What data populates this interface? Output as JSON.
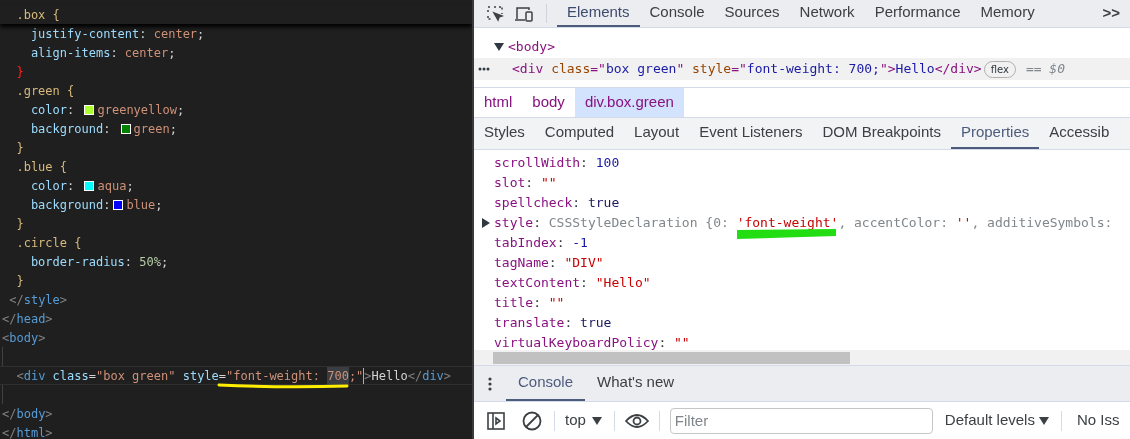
{
  "editor": {
    "lines": [
      {
        "tokens": [
          {
            "text": "  .box",
            "kind": "selector"
          },
          {
            "text": " {",
            "kind": "brace"
          }
        ],
        "sticky": true
      },
      {
        "tokens": [
          {
            "text": "    justify-content",
            "kind": "prop"
          },
          {
            "text": ": ",
            "kind": "text"
          },
          {
            "text": "center",
            "kind": "value"
          },
          {
            "text": ";",
            "kind": "text"
          }
        ]
      },
      {
        "tokens": [
          {
            "text": "    align-items",
            "kind": "prop"
          },
          {
            "text": ": ",
            "kind": "text"
          },
          {
            "text": "center",
            "kind": "value"
          },
          {
            "text": ";",
            "kind": "text"
          }
        ]
      },
      {
        "tokens": [
          {
            "text": "  }",
            "kind": "brace_error"
          }
        ]
      },
      {
        "tokens": [
          {
            "text": "  .green",
            "kind": "selector"
          },
          {
            "text": " {",
            "kind": "brace"
          }
        ]
      },
      {
        "tokens": [
          {
            "text": "    color",
            "kind": "prop"
          },
          {
            "text": ": ",
            "kind": "text"
          },
          {
            "kind": "swatch",
            "color": "#adff2f"
          },
          {
            "text": "greenyellow",
            "kind": "value"
          },
          {
            "text": ";",
            "kind": "text"
          }
        ]
      },
      {
        "tokens": [
          {
            "text": "    background",
            "kind": "prop"
          },
          {
            "text": ": ",
            "kind": "text"
          },
          {
            "kind": "swatch",
            "color": "#008000"
          },
          {
            "text": "green",
            "kind": "value"
          },
          {
            "text": ";",
            "kind": "text"
          }
        ]
      },
      {
        "tokens": [
          {
            "text": "  }",
            "kind": "brace"
          }
        ]
      },
      {
        "tokens": [
          {
            "text": "  .blue",
            "kind": "selector"
          },
          {
            "text": " {",
            "kind": "brace"
          }
        ]
      },
      {
        "tokens": [
          {
            "text": "    color",
            "kind": "prop"
          },
          {
            "text": ": ",
            "kind": "text"
          },
          {
            "kind": "swatch",
            "color": "#00ffff"
          },
          {
            "text": "aqua",
            "kind": "value"
          },
          {
            "text": ";",
            "kind": "text"
          }
        ]
      },
      {
        "tokens": [
          {
            "text": "    background",
            "kind": "prop"
          },
          {
            "text": ":",
            "kind": "text"
          },
          {
            "kind": "swatch",
            "color": "#0000ff"
          },
          {
            "text": "blue",
            "kind": "value"
          },
          {
            "text": ";",
            "kind": "text"
          }
        ]
      },
      {
        "tokens": [
          {
            "text": "  }",
            "kind": "brace"
          }
        ]
      },
      {
        "tokens": [
          {
            "text": "  .circle",
            "kind": "selector"
          },
          {
            "text": " {",
            "kind": "brace"
          }
        ]
      },
      {
        "tokens": [
          {
            "text": "    border-radius",
            "kind": "prop"
          },
          {
            "text": ": ",
            "kind": "text"
          },
          {
            "text": "50%",
            "kind": "number"
          },
          {
            "text": ";",
            "kind": "text"
          }
        ]
      },
      {
        "tokens": [
          {
            "text": "  }",
            "kind": "brace"
          }
        ]
      },
      {
        "tokens": [
          {
            "text": " </",
            "kind": "punct"
          },
          {
            "text": "style",
            "kind": "tag"
          },
          {
            "text": ">",
            "kind": "punct"
          }
        ]
      },
      {
        "tokens": [
          {
            "text": "</",
            "kind": "punct"
          },
          {
            "text": "head",
            "kind": "tag"
          },
          {
            "text": ">",
            "kind": "punct"
          }
        ]
      },
      {
        "tokens": [
          {
            "text": "<",
            "kind": "punct"
          },
          {
            "text": "body",
            "kind": "tag"
          },
          {
            "text": ">",
            "kind": "punct"
          }
        ]
      },
      {
        "kind": "blank"
      },
      {
        "tokens": [
          {
            "text": "  <",
            "kind": "punct"
          },
          {
            "text": "div",
            "kind": "tag"
          },
          {
            "text": " class",
            "kind": "attr"
          },
          {
            "text": "=",
            "kind": "text"
          },
          {
            "text": "\"box green\"",
            "kind": "value"
          },
          {
            "text": " style",
            "kind": "attr"
          },
          {
            "text": "=",
            "kind": "text"
          },
          {
            "text": "\"font-weight: ",
            "kind": "value"
          },
          {
            "text": "700",
            "kind": "selection"
          },
          {
            "text": ";\"",
            "kind": "value"
          },
          {
            "kind": "cursor"
          },
          {
            "text": ">",
            "kind": "punct"
          },
          {
            "text": "Hello",
            "kind": "text"
          },
          {
            "text": "</",
            "kind": "punct"
          },
          {
            "text": "div",
            "kind": "tag"
          },
          {
            "text": ">",
            "kind": "punct"
          }
        ],
        "current": true
      },
      {
        "kind": "blank"
      },
      {
        "tokens": [
          {
            "text": "</",
            "kind": "punct"
          },
          {
            "text": "body",
            "kind": "tag"
          },
          {
            "text": ">",
            "kind": "punct"
          }
        ]
      },
      {
        "tokens": [
          {
            "text": "</",
            "kind": "punct"
          },
          {
            "text": "html",
            "kind": "tag"
          },
          {
            "text": ">",
            "kind": "punct"
          }
        ]
      }
    ]
  },
  "devtools": {
    "tabs": [
      {
        "label": "Elements",
        "selected": true
      },
      {
        "label": "Console",
        "selected": false
      },
      {
        "label": "Sources",
        "selected": false
      },
      {
        "label": "Network",
        "selected": false
      },
      {
        "label": "Performance",
        "selected": false
      },
      {
        "label": "Memory",
        "selected": false
      }
    ],
    "more_tabs": ">>",
    "dom_tree": [
      {
        "tokens": [
          {
            "text": "<body>",
            "kind": "tag"
          }
        ],
        "expanded": true,
        "selected": false
      },
      {
        "tokens": [
          {
            "text": "<div",
            "kind": "tag"
          },
          {
            "text": " class",
            "kind": "attr"
          },
          {
            "text": "=\"",
            "kind": "tag"
          },
          {
            "text": "box green",
            "kind": "value"
          },
          {
            "text": "\"",
            "kind": "tag"
          },
          {
            "text": " style",
            "kind": "attr"
          },
          {
            "text": "=\"",
            "kind": "tag"
          },
          {
            "text": "font-weight: 700;",
            "kind": "value"
          },
          {
            "text": "\">",
            "kind": "tag"
          },
          {
            "text": "Hello",
            "kind": "value"
          },
          {
            "text": "</div>",
            "kind": "tag"
          }
        ],
        "badge": "flex",
        "suffix": "== $0",
        "selected": true
      }
    ],
    "breadcrumbs": [
      {
        "label": "html",
        "selected": false
      },
      {
        "label": "body",
        "selected": false
      },
      {
        "label": "div.box.green",
        "selected": true
      }
    ],
    "subtabs": [
      {
        "label": "Styles",
        "selected": false
      },
      {
        "label": "Computed",
        "selected": false
      },
      {
        "label": "Layout",
        "selected": false
      },
      {
        "label": "Event Listeners",
        "selected": false
      },
      {
        "label": "DOM Breakpoints",
        "selected": false
      },
      {
        "label": "Properties",
        "selected": true
      },
      {
        "label": "Accessib",
        "selected": false
      }
    ],
    "properties": [
      {
        "name": "scrollWidth",
        "value": [
          {
            "text": ": ",
            "kind": "colon"
          },
          {
            "text": "100",
            "kind": "number"
          }
        ]
      },
      {
        "name": "slot",
        "value": [
          {
            "text": ": ",
            "kind": "colon"
          },
          {
            "text": "\"\"",
            "kind": "string"
          }
        ]
      },
      {
        "name": "spellcheck",
        "value": [
          {
            "text": ": ",
            "kind": "colon"
          },
          {
            "text": "true",
            "kind": "keyword"
          }
        ]
      },
      {
        "name": "style",
        "expandable": true,
        "value": [
          {
            "text": ": ",
            "kind": "colon"
          },
          {
            "text": "CSSStyleDeclaration {0: ",
            "kind": "preview"
          },
          {
            "text": "'font-weight'",
            "kind": "string"
          },
          {
            "text": ", accentColor: ",
            "kind": "preview"
          },
          {
            "text": "''",
            "kind": "string"
          },
          {
            "text": ", additiveSymbols:",
            "kind": "preview"
          }
        ]
      },
      {
        "name": "tabIndex",
        "value": [
          {
            "text": ": ",
            "kind": "colon"
          },
          {
            "text": "-1",
            "kind": "number"
          }
        ]
      },
      {
        "name": "tagName",
        "value": [
          {
            "text": ": ",
            "kind": "colon"
          },
          {
            "text": "\"DIV\"",
            "kind": "string"
          }
        ]
      },
      {
        "name": "textContent",
        "value": [
          {
            "text": ": ",
            "kind": "colon"
          },
          {
            "text": "\"Hello\"",
            "kind": "string"
          }
        ]
      },
      {
        "name": "title",
        "value": [
          {
            "text": ": ",
            "kind": "colon"
          },
          {
            "text": "\"\"",
            "kind": "string"
          }
        ]
      },
      {
        "name": "translate",
        "value": [
          {
            "text": ": ",
            "kind": "colon"
          },
          {
            "text": "true",
            "kind": "keyword"
          }
        ]
      },
      {
        "name": "virtualKeyboardPolicy",
        "value": [
          {
            "text": ": ",
            "kind": "colon"
          },
          {
            "text": "\"\"",
            "kind": "string"
          }
        ]
      }
    ],
    "drawer_tabs": [
      {
        "label": "Console",
        "selected": true
      },
      {
        "label": "What's new",
        "selected": false
      }
    ],
    "console_toolbar": {
      "context": "top",
      "filter": {
        "placeholder": "Filter"
      },
      "levels": "Default levels",
      "issues": "No Iss"
    }
  }
}
